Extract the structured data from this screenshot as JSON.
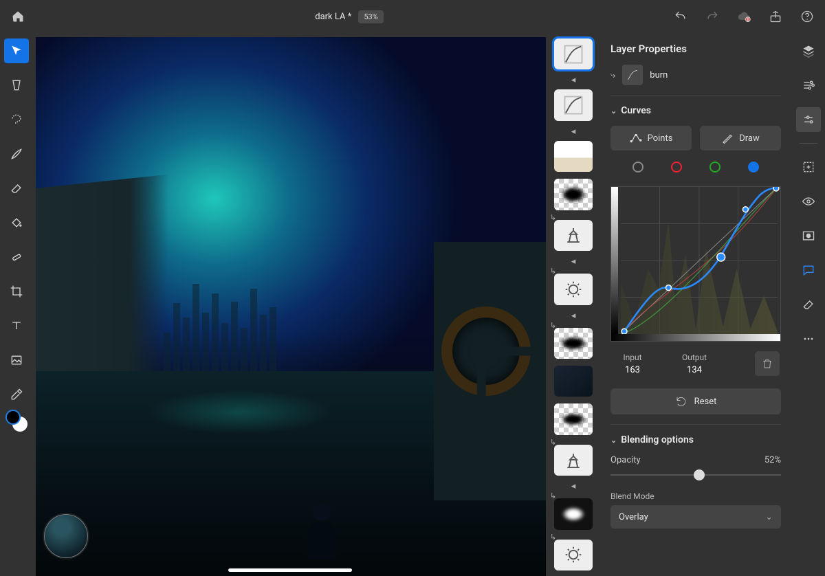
{
  "topbar": {
    "doc_title": "dark LA *",
    "zoom": "53%"
  },
  "left_tools": [
    {
      "name": "move",
      "active": true
    },
    {
      "name": "transform"
    },
    {
      "name": "lasso"
    },
    {
      "name": "brush"
    },
    {
      "name": "eraser"
    },
    {
      "name": "fill"
    },
    {
      "name": "heal"
    },
    {
      "name": "crop"
    },
    {
      "name": "type"
    },
    {
      "name": "place-image"
    },
    {
      "name": "eyedropper"
    }
  ],
  "panel": {
    "title": "Layer Properties",
    "layer_name": "burn",
    "curves_label": "Curves",
    "points_label": "Points",
    "draw_label": "Draw",
    "input_label": "Input",
    "output_label": "Output",
    "input_value": "163",
    "output_value": "134",
    "reset_label": "Reset",
    "blending_label": "Blending options",
    "opacity_label": "Opacity",
    "opacity_value": "52%",
    "opacity_pct": 52,
    "blend_mode_label": "Blend Mode",
    "blend_mode_value": "Overlay"
  },
  "layers": [
    {
      "kind": "curves",
      "selected": true
    },
    {
      "kind": "curves"
    },
    {
      "kind": "person"
    },
    {
      "kind": "mask"
    },
    {
      "kind": "balance",
      "linked": true
    },
    {
      "kind": "exposure",
      "linked": true
    },
    {
      "kind": "mask",
      "linked": true
    },
    {
      "kind": "photo"
    },
    {
      "kind": "mask"
    },
    {
      "kind": "balance",
      "linked": true
    },
    {
      "kind": "mask-dark",
      "linked": true
    },
    {
      "kind": "exposure",
      "linked": true
    }
  ],
  "channels": {
    "selected": "b"
  }
}
